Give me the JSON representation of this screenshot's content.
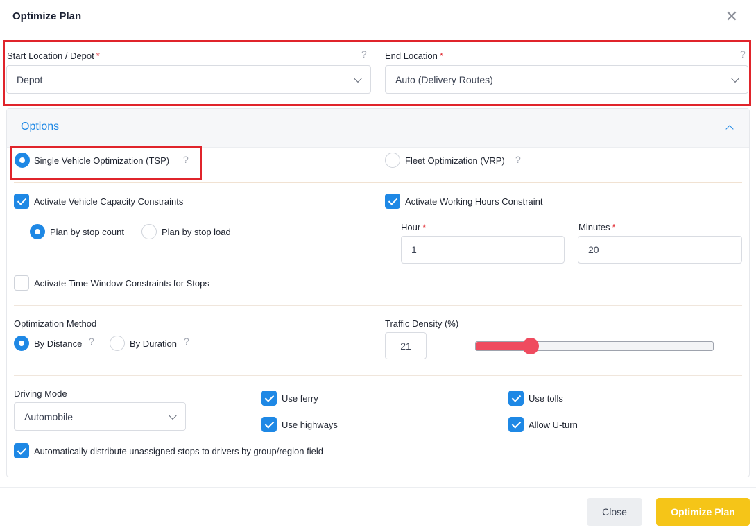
{
  "dialog": {
    "title": "Optimize Plan"
  },
  "locations": {
    "start_label": "Start Location / Depot",
    "start_value": "Depot",
    "end_label": "End Location",
    "end_value": "Auto (Delivery Routes)",
    "required_mark": "*",
    "help_mark": "?"
  },
  "options": {
    "title": "Options",
    "mode": {
      "tsp_label": "Single Vehicle Optimization (TSP)",
      "tsp_selected": true,
      "vrp_label": "Fleet Optimization (VRP)",
      "vrp_selected": false
    },
    "capacity": {
      "label": "Activate Vehicle Capacity Constraints",
      "checked": true,
      "by_count_label": "Plan by stop count",
      "by_count_selected": true,
      "by_load_label": "Plan by stop load",
      "by_load_selected": false
    },
    "working_hours": {
      "label": "Activate Working Hours Constraint",
      "checked": true,
      "hour_label": "Hour",
      "hour_value": "1",
      "minutes_label": "Minutes",
      "minutes_value": "20"
    },
    "time_window": {
      "label": "Activate Time Window Constraints for Stops",
      "checked": false
    },
    "method": {
      "label": "Optimization Method",
      "by_distance_label": "By Distance",
      "by_distance_selected": true,
      "by_duration_label": "By Duration",
      "by_duration_selected": false
    },
    "traffic": {
      "label": "Traffic Density (%)",
      "value": "21",
      "slider_fraction": 0.23
    },
    "driving": {
      "label": "Driving Mode",
      "value": "Automobile"
    },
    "use_ferry": {
      "label": "Use ferry",
      "checked": true
    },
    "use_highways": {
      "label": "Use highways",
      "checked": true
    },
    "use_tolls": {
      "label": "Use tolls",
      "checked": true
    },
    "allow_uturn": {
      "label": "Allow U-turn",
      "checked": true
    },
    "auto_distribute": {
      "label": "Automatically distribute unassigned stops to drivers by group/region field",
      "checked": true
    }
  },
  "footer": {
    "close_label": "Close",
    "optimize_label": "Optimize Plan"
  },
  "colors": {
    "accent": "#1e88e5",
    "danger": "#e0242b",
    "primary_button": "#f5c518",
    "slider": "#ef4b5f"
  }
}
